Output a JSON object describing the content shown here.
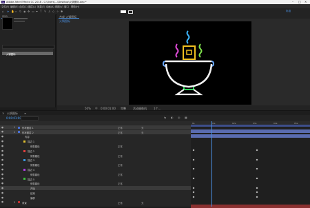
{
  "titlebar": {
    "title": "Adobe After Effects CC 2018 - C:\\Users\\...\\Desktop\\火锅图标.aep *",
    "app_icon": "Ae"
  },
  "menu": [
    "文件(F)",
    "编辑(E)",
    "合成(C)",
    "图层(L)",
    "效果(T)",
    "动画(A)",
    "视图(V)",
    "窗口",
    "帮助(H)"
  ],
  "toolbar": {
    "workspace": "标准",
    "tools": [
      "home-icon",
      "select-icon",
      "hand-icon",
      "zoom-icon",
      "rotate-icon",
      "camera-icon",
      "pan-icon",
      "rect-mask-icon",
      "pen-icon",
      "text-icon",
      "brush-icon",
      "stamp-icon",
      "eraser-icon",
      "roto-icon",
      "puppet-icon"
    ]
  },
  "project_panel": {
    "tab": "项目",
    "search_placeholder": "",
    "selected_item": "火锅图标"
  },
  "comp_panel": {
    "tab": "合成 火锅图标",
    "breadcrumb": "火锅图标"
  },
  "viewer_bar": {
    "zoom": "50%",
    "timecode": "0:00:01:00",
    "resolution": "完整",
    "camera": "活动摄像机",
    "view": "1个..."
  },
  "timeline": {
    "tab": "火锅图标",
    "timecode": "0:00:01:00",
    "columns": {
      "source": "源名称",
      "mode": "模式",
      "trkmat": "TrkMat",
      "parent": "父级"
    },
    "ruler": [
      "0s",
      "01s",
      "02s",
      "03s",
      "04s",
      "05s"
    ],
    "layers": [
      {
        "num": "1",
        "name": "形状图层 1",
        "color": "#4a6fd1",
        "mode": "正常",
        "parent": "无",
        "selected": true
      },
      {
        "num": "2",
        "name": "形状图层 2",
        "color": "#4a6fd1",
        "mode": "正常",
        "parent": "无",
        "selected": true
      },
      {
        "num": "",
        "name": "内容",
        "color": "",
        "mode": "",
        "parent": "",
        "selected": false
      },
      {
        "num": "",
        "name": "描边 1",
        "color": "#e4c330",
        "mode": "",
        "parent": "",
        "selected": false
      },
      {
        "num": "",
        "name": "修剪路径",
        "color": "",
        "mode": "正常",
        "parent": "",
        "selected": false
      },
      {
        "num": "",
        "name": "描边 2",
        "color": "#e44040",
        "mode": "",
        "parent": "",
        "selected": false
      },
      {
        "num": "",
        "name": "修剪路径",
        "color": "",
        "mode": "正常",
        "parent": "",
        "selected": false
      },
      {
        "num": "",
        "name": "描边 3",
        "color": "#3a9ae4",
        "mode": "",
        "parent": "",
        "selected": false
      },
      {
        "num": "",
        "name": "修剪路径",
        "color": "",
        "mode": "正常",
        "parent": "",
        "selected": false
      },
      {
        "num": "",
        "name": "描边 4",
        "color": "#b040e4",
        "mode": "",
        "parent": "",
        "selected": false
      },
      {
        "num": "",
        "name": "修剪路径",
        "color": "",
        "mode": "正常",
        "parent": "",
        "selected": false
      },
      {
        "num": "",
        "name": "描边 5",
        "color": "#40c040",
        "mode": "",
        "parent": "",
        "selected": false
      },
      {
        "num": "",
        "name": "修剪路径",
        "color": "",
        "mode": "正常",
        "parent": "",
        "selected": false
      },
      {
        "num": "",
        "name": "开始",
        "color": "",
        "mode": "",
        "parent": "",
        "selected": true
      },
      {
        "num": "",
        "name": "结束",
        "color": "",
        "mode": "",
        "parent": "",
        "selected": false
      },
      {
        "num": "",
        "name": "偏移",
        "color": "",
        "mode": "",
        "parent": "",
        "selected": false
      },
      {
        "num": "3",
        "name": "背景",
        "color": "#c03030",
        "mode": "正常",
        "parent": "无",
        "selected": false
      }
    ],
    "playhead_label": ""
  },
  "icon_colors": {
    "steam_left": "#e04bd8",
    "steam_mid": "#3db6ff",
    "steam_right": "#7ee04b",
    "bowl": "#f2f2f2",
    "pot_top": "#f0c020",
    "handle": "#6aa8ff",
    "base_green": "#2fcf5a",
    "base_white": "#f5f5f5"
  },
  "accent": "#4a8fe0"
}
